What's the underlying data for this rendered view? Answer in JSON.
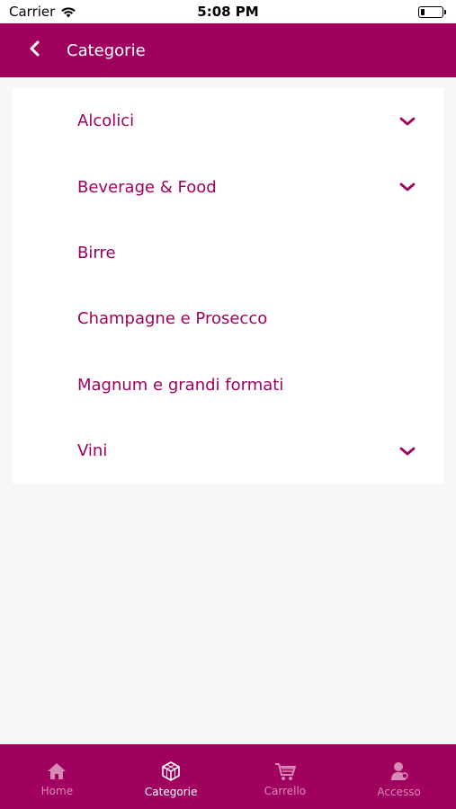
{
  "status_bar": {
    "carrier": "Carrier",
    "time": "5:08 PM",
    "battery_level": 0.2
  },
  "header": {
    "title": "Categorie",
    "back_icon": "chevron-left-icon",
    "background": "#a0005e"
  },
  "categories": [
    {
      "label": "Alcolici",
      "expandable": true
    },
    {
      "label": "Beverage & Food",
      "expandable": true
    },
    {
      "label": "Birre",
      "expandable": false
    },
    {
      "label": "Champagne e Prosecco",
      "expandable": false
    },
    {
      "label": "Magnum e grandi formati",
      "expandable": false
    },
    {
      "label": "Vini",
      "expandable": true
    }
  ],
  "tab_bar": {
    "tabs": [
      {
        "label": "Home",
        "icon": "home-icon",
        "active": false
      },
      {
        "label": "Categorie",
        "icon": "cube-icon",
        "active": true
      },
      {
        "label": "Carrello",
        "icon": "cart-icon",
        "active": false
      },
      {
        "label": "Accesso",
        "icon": "user-icon",
        "active": false
      }
    ]
  },
  "colors": {
    "accent": "#a0005e",
    "background": "#f7f7f7",
    "inactive_tab": "#d88ab6"
  }
}
